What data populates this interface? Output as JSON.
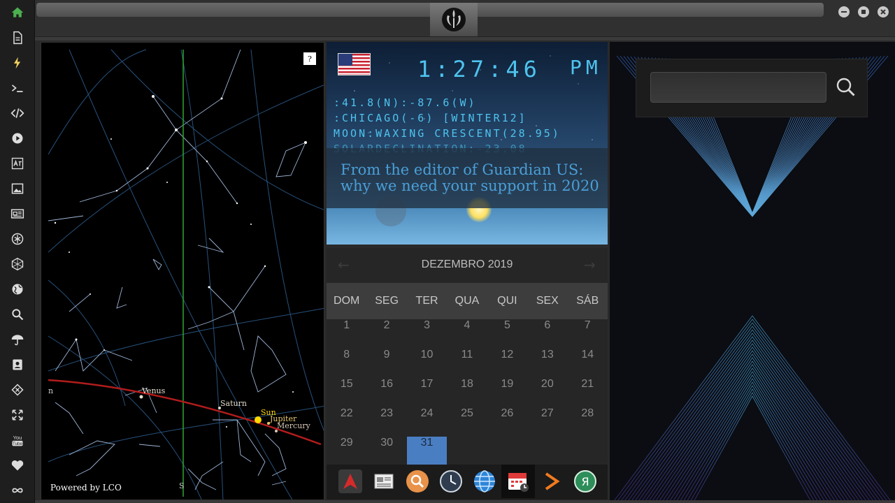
{
  "sidebar": {
    "items": [
      {
        "name": "home-icon",
        "color": "#4caf50"
      },
      {
        "name": "document-icon"
      },
      {
        "name": "lightning-icon"
      },
      {
        "name": "terminal-icon"
      },
      {
        "name": "code-icon"
      },
      {
        "name": "play-icon"
      },
      {
        "name": "translate-icon"
      },
      {
        "name": "image-icon"
      },
      {
        "name": "newspaper-icon"
      },
      {
        "name": "rebel-icon"
      },
      {
        "name": "hexagon-icon"
      },
      {
        "name": "globe-icon"
      },
      {
        "name": "search-icon"
      },
      {
        "name": "umbrella-icon"
      },
      {
        "name": "contact-card-icon"
      },
      {
        "name": "git-icon"
      },
      {
        "name": "expand-icon"
      },
      {
        "name": "youtube-icon",
        "label": "You Tube"
      },
      {
        "name": "heart-icon"
      },
      {
        "name": "infinity-icon"
      }
    ]
  },
  "window": {
    "logo": "rebel-alliance-logo"
  },
  "sky": {
    "help_label": "?",
    "powered_by": "Powered by LCO",
    "horizon_label_n": "n",
    "horizon_label_s": "S",
    "planets": [
      {
        "name": "Venus",
        "color": "#e8e0d0"
      },
      {
        "name": "Saturn",
        "color": "#e0d8c8"
      },
      {
        "name": "Sun",
        "color": "#ffd800"
      },
      {
        "name": "Jupiter",
        "color": "#e8c870"
      },
      {
        "name": "Mercury",
        "color": "#d8c8b8"
      }
    ]
  },
  "clock": {
    "time": "1:27:46",
    "ampm": "PM",
    "coords": ":41.8(N):-87.6(W)",
    "location": ":CHICAGO(-6) [WINTER12]",
    "moon": "MOON:WAXING CRESCENT(28.95)",
    "solar": "SOLARDECLINATION:-23.08",
    "news_title": "From the editor of Guardian US: why we need your support in 2020",
    "text_color": "#4ec3ee"
  },
  "calendar": {
    "title": "DEZEMBRO 2019",
    "prev": "←",
    "next": "→",
    "weekdays": [
      "DOM",
      "SEG",
      "TER",
      "QUA",
      "QUI",
      "SEX",
      "SÁB"
    ],
    "weeks": [
      [
        "1",
        "2",
        "3",
        "4",
        "5",
        "6",
        "7"
      ],
      [
        "8",
        "9",
        "10",
        "11",
        "12",
        "13",
        "14"
      ],
      [
        "15",
        "16",
        "17",
        "18",
        "19",
        "20",
        "21"
      ],
      [
        "22",
        "23",
        "24",
        "25",
        "26",
        "27",
        "28"
      ],
      [
        "29",
        "30",
        "31",
        "",
        "",
        "",
        ""
      ]
    ],
    "today": "31",
    "accent": "#4a7ec2"
  },
  "dock": {
    "items": [
      {
        "name": "arch-app-icon"
      },
      {
        "name": "news-app-icon"
      },
      {
        "name": "search-app-icon"
      },
      {
        "name": "clock-app-icon"
      },
      {
        "name": "globe-app-icon"
      },
      {
        "name": "calendar-app-icon",
        "active": true
      },
      {
        "name": "arrow-app-icon"
      },
      {
        "name": "yandex-app-icon",
        "label": "Я"
      }
    ]
  }
}
